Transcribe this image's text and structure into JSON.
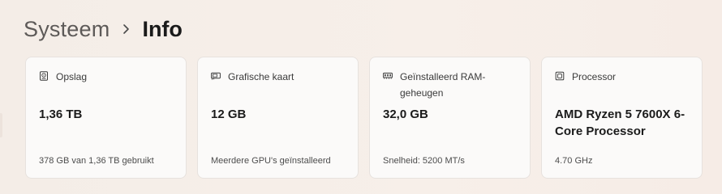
{
  "breadcrumb": {
    "parent": "Systeem",
    "current": "Info"
  },
  "cards": [
    {
      "icon": "storage-icon",
      "title": "Opslag",
      "value": "1,36 TB",
      "footer": "378 GB van 1,36 TB gebruikt"
    },
    {
      "icon": "graphics-card-icon",
      "title": "Grafische kaart",
      "value": "12 GB",
      "footer": "Meerdere GPU's geïnstalleerd"
    },
    {
      "icon": "memory-icon",
      "title": "Geïnstalleerd RAM-geheugen",
      "value": "32,0 GB",
      "footer": "Snelheid: 5200 MT/s"
    },
    {
      "icon": "processor-icon",
      "title": "Processor",
      "value": "AMD Ryzen 5 7600X 6-Core Processor",
      "footer": "4.70 GHz"
    }
  ],
  "colors": {
    "background": "#f5ede6",
    "card": "#fbfaf9",
    "card_border": "#e7e2de"
  }
}
